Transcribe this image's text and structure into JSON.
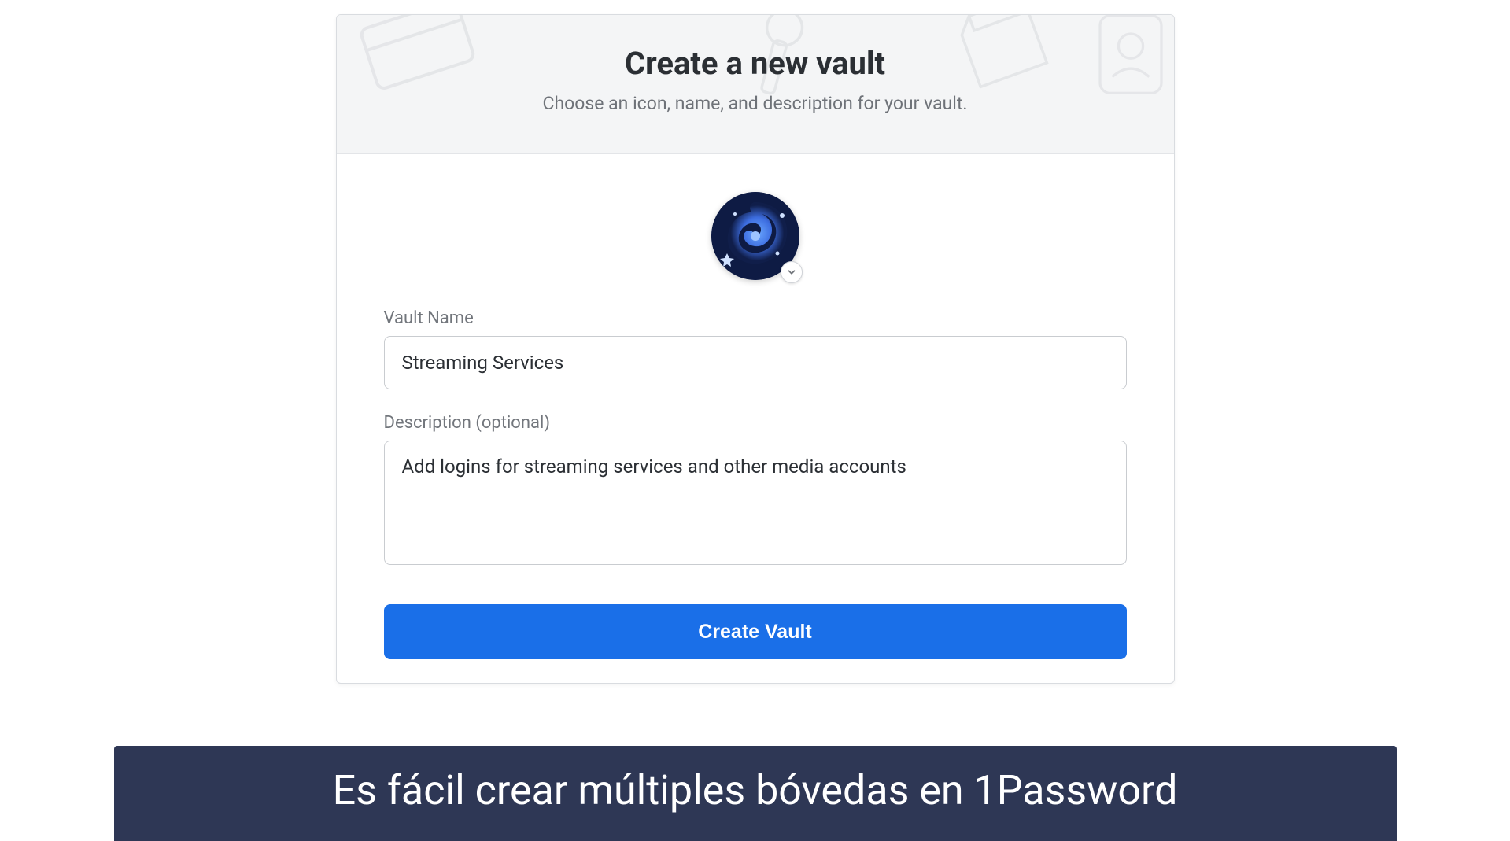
{
  "header": {
    "title": "Create a new vault",
    "subtitle": "Choose an icon, name, and description for your vault."
  },
  "form": {
    "icon_name": "galaxy-icon",
    "vault_name_label": "Vault Name",
    "vault_name_value": "Streaming Services",
    "description_label": "Description (optional)",
    "description_value": "Add logins for streaming services and other media accounts",
    "submit_label": "Create Vault"
  },
  "caption": "Es fácil crear múltiples bóvedas en 1Password",
  "colors": {
    "primary_button": "#1a6fe8",
    "caption_bg": "#2e3755"
  }
}
